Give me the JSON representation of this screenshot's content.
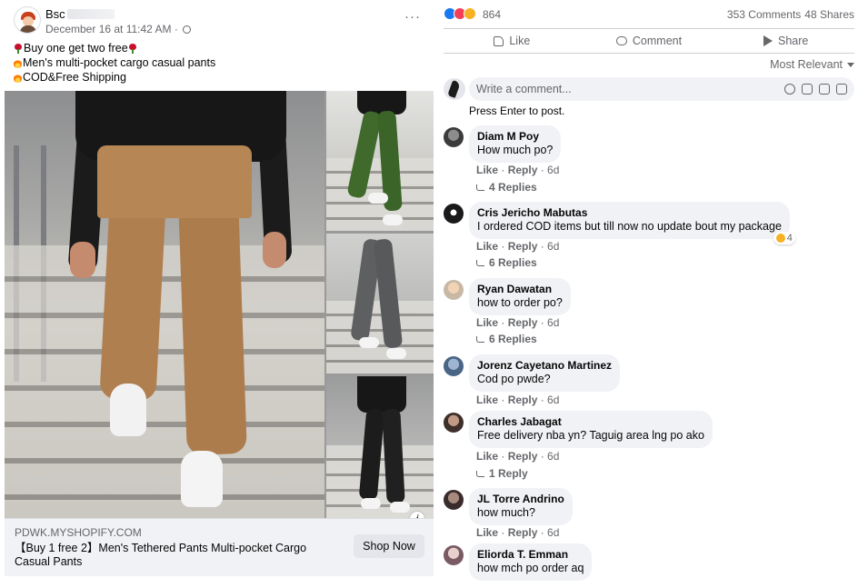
{
  "post": {
    "page_name": "Bsc",
    "timestamp": "December 16 at 11:42 AM ·",
    "more_label": "···",
    "text_lines": [
      {
        "icon": "rose",
        "text": "Buy one get two free"
      },
      {
        "icon": "fire",
        "text": "Men's multi-pocket cargo casual pants"
      },
      {
        "icon": "fire",
        "text": "COD&Free Shipping"
      }
    ],
    "link": {
      "domain": "PDWK.MYSHOPIFY.COM",
      "title": "【Buy 1 free 2】Men's Tethered Pants Multi-pocket Cargo Casual Pants",
      "cta_label": "Shop Now",
      "info_label": "i"
    }
  },
  "engagement": {
    "reaction_count": "864",
    "comments": "353 Comments",
    "shares": "48 Shares"
  },
  "actions": {
    "like_label": "Like",
    "comment_label": "Comment",
    "share_label": "Share"
  },
  "sort": {
    "label": "Most Relevant"
  },
  "composer": {
    "placeholder": "Write a comment...",
    "hint": "Press Enter to post."
  },
  "comments": [
    {
      "name": "Diam M Poy",
      "text": "How much po?",
      "like": "Like",
      "reply": "Reply",
      "time": "6d",
      "replies": "4 Replies",
      "reaction": ""
    },
    {
      "name": "Cris Jericho Mabutas",
      "text": "I ordered COD items but till now no update bout my package",
      "like": "Like",
      "reply": "Reply",
      "time": "6d",
      "replies": "6 Replies",
      "reaction": "4"
    },
    {
      "name": "Ryan Dawatan",
      "text": "how to order po?",
      "like": "Like",
      "reply": "Reply",
      "time": "6d",
      "replies": "6 Replies",
      "reaction": ""
    },
    {
      "name": "Jorenz Cayetano Martinez",
      "text": "Cod po pwde?",
      "like": "Like",
      "reply": "Reply",
      "time": "6d",
      "replies": "",
      "reaction": ""
    },
    {
      "name": "Charles Jabagat",
      "text": "Free delivery nba yn? Taguig area lng po ako",
      "like": "Like",
      "reply": "Reply",
      "time": "6d",
      "replies": "1 Reply",
      "reaction": ""
    },
    {
      "name": "JL Torre Andrino",
      "text": "how much?",
      "like": "Like",
      "reply": "Reply",
      "time": "6d",
      "replies": "",
      "reaction": ""
    },
    {
      "name": "Eliorda T. Emman",
      "text": "how mch po order aq",
      "like": "",
      "reply": "",
      "time": "",
      "replies": "",
      "reaction": ""
    }
  ],
  "colors": {
    "muted_text": "#65676b",
    "bubble_bg": "#f0f2f5",
    "like_blue": "#1877f2",
    "love_red": "#f33e58",
    "wow_yellow": "#f7b125"
  }
}
